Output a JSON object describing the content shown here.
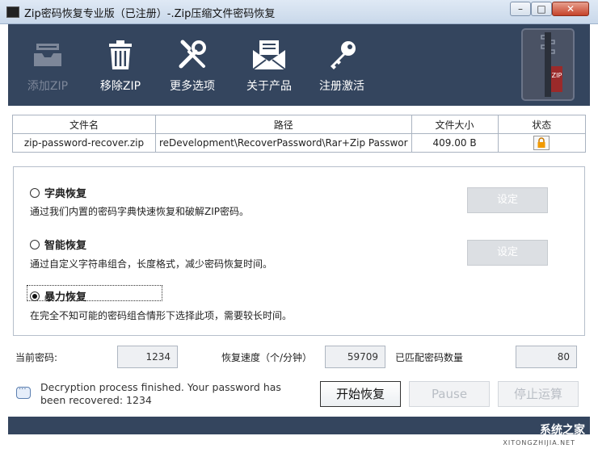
{
  "window": {
    "title": "Zip密码恢复专业版（已注册）-.Zip压缩文件密码恢复",
    "controls": {
      "minimize": "–",
      "maximize": "□",
      "close": "✕"
    }
  },
  "toolbar": {
    "items": [
      {
        "label": "添加ZIP",
        "icon": "inbox-tray-icon",
        "enabled": false
      },
      {
        "label": "移除ZIP",
        "icon": "trash-icon",
        "enabled": true
      },
      {
        "label": "更多选项",
        "icon": "tools-icon",
        "enabled": true
      },
      {
        "label": "关于产品",
        "icon": "envelope-icon",
        "enabled": true
      },
      {
        "label": "注册激活",
        "icon": "key-icon",
        "enabled": true
      }
    ],
    "logo_text": "ZIP"
  },
  "table": {
    "headers": [
      "文件名",
      "路径",
      "文件大小",
      "状态"
    ],
    "rows": [
      {
        "name": "zip-password-recover.zip",
        "path": "reDevelopment\\RecoverPassword\\Rar+Zip Passwor",
        "size": "409.00 B",
        "status_icon": "lock-icon"
      }
    ]
  },
  "options": {
    "dictionary": {
      "title": "字典恢复",
      "desc": "通过我们内置的密码字典快速恢复和破解ZIP密码。",
      "button": "设定",
      "checked": false
    },
    "smart": {
      "title": "智能恢复",
      "desc": "通过自定义字符串组合，长度格式，减少密码恢复时间。",
      "button": "设定",
      "checked": false
    },
    "brute": {
      "title": "暴力恢复",
      "desc": "在完全不知可能的密码组合情形下选择此项，需要较长时间。",
      "checked": true
    }
  },
  "stats": {
    "current_password_label": "当前密码:",
    "current_password": "1234",
    "speed_label": "恢复速度（个/分钟）",
    "speed": "59709",
    "matched_label": "已匹配密码数量",
    "matched": "80"
  },
  "status": {
    "message": "Decryption process finished. Your password has been recovered: 1234"
  },
  "buttons": {
    "start": "开始恢复",
    "pause": "Pause",
    "stop": "停止运算"
  },
  "watermark": {
    "text": "系统之家",
    "sub": "XITONGZHIJIA.NET"
  },
  "colors": {
    "toolbar_bg": "#34455e",
    "disabled_text": "#b9bec5"
  }
}
